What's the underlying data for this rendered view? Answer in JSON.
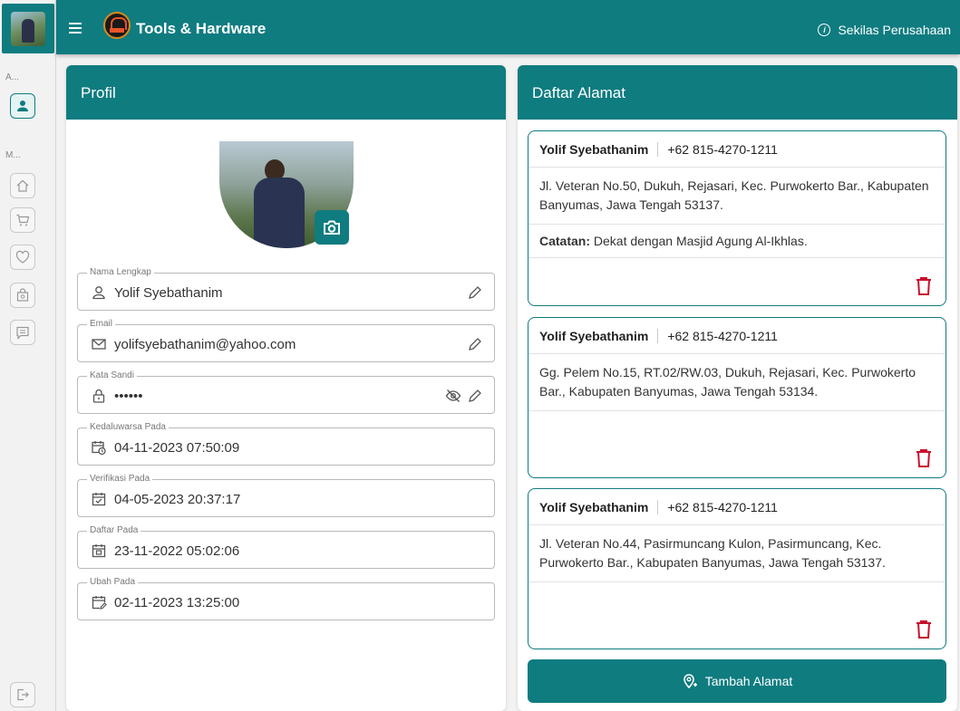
{
  "app": {
    "title": "Tools & Hardware",
    "company_link": "Sekilas Perusahaan"
  },
  "rail": {
    "section_a": "A...",
    "section_m": "M..."
  },
  "profile": {
    "title": "Profil",
    "fields": [
      {
        "label": "Nama Lengkap",
        "value": "Yolif Syebathanim",
        "icon": "user-icon"
      },
      {
        "label": "Email",
        "value": "yolifsyebathanim@yahoo.com",
        "icon": "mail-icon"
      },
      {
        "label": "Kata Sandi",
        "value": "••••••",
        "icon": "lock-icon"
      },
      {
        "label": "Kedaluwarsa Pada",
        "value": "04-11-2023 07:50:09",
        "icon": "calendar-clock-icon"
      },
      {
        "label": "Verifikasi Pada",
        "value": "04-05-2023 20:37:17",
        "icon": "calendar-check-icon"
      },
      {
        "label": "Daftar Pada",
        "value": "23-11-2022 05:02:06",
        "icon": "calendar-icon"
      },
      {
        "label": "Ubah Pada",
        "value": "02-11-2023 13:25:00",
        "icon": "calendar-edit-icon"
      }
    ]
  },
  "addresses": {
    "title": "Daftar Alamat",
    "items": [
      {
        "name": "Yolif Syebathanim",
        "phone": "+62 815-4270-1211",
        "address": "Jl. Veteran No.50, Dukuh, Rejasari, Kec. Purwokerto Bar., Kabupaten Banyumas, Jawa Tengah 53137.",
        "note_label": "Catatan:",
        "note": " Dekat dengan Masjid Agung Al-Ikhlas."
      },
      {
        "name": "Yolif Syebathanim",
        "phone": "+62 815-4270-1211",
        "address": "Gg. Pelem No.15, RT.02/RW.03, Dukuh, Rejasari, Kec. Purwokerto Bar., Kabupaten Banyumas, Jawa Tengah 53134."
      },
      {
        "name": "Yolif Syebathanim",
        "phone": "+62 815-4270-1211",
        "address": "Jl. Veteran No.44, Pasirmuncang Kulon, Pasirmuncang, Kec. Purwokerto Bar., Kabupaten Banyumas, Jawa Tengah 53137."
      }
    ],
    "add_button": "Tambah Alamat"
  },
  "colors": {
    "primary": "#0f7c80",
    "danger": "#c8102e"
  }
}
